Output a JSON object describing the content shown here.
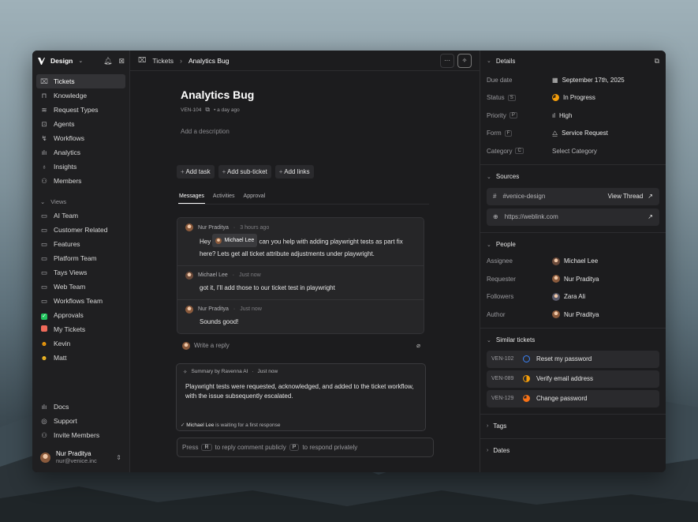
{
  "workspace": {
    "name": "Design"
  },
  "sidebar": {
    "nav": [
      {
        "label": "Tickets",
        "icon": "ticket-icon",
        "glyph": "⌧"
      },
      {
        "label": "Knowledge",
        "icon": "book-icon",
        "glyph": "⊓"
      },
      {
        "label": "Request Types",
        "icon": "layers-icon",
        "glyph": "≋"
      },
      {
        "label": "Agents",
        "icon": "bot-icon",
        "glyph": "⊡"
      },
      {
        "label": "Workflows",
        "icon": "workflow-icon",
        "glyph": "↯"
      },
      {
        "label": "Analytics",
        "icon": "chart-icon",
        "glyph": "ılı"
      },
      {
        "label": "Insights",
        "icon": "lightbulb-icon",
        "glyph": "♁"
      },
      {
        "label": "Members",
        "icon": "users-icon",
        "glyph": "⚇"
      }
    ],
    "views_label": "Views",
    "views": [
      {
        "label": "AI Team",
        "icon": "folder-icon",
        "glyph": "▭"
      },
      {
        "label": "Customer Related",
        "icon": "folder-icon",
        "glyph": "▭"
      },
      {
        "label": "Features",
        "icon": "folder-icon",
        "glyph": "▭"
      },
      {
        "label": "Platform Team",
        "icon": "folder-icon",
        "glyph": "▭"
      },
      {
        "label": "Tays Views",
        "icon": "folder-icon",
        "glyph": "▭"
      },
      {
        "label": "Web Team",
        "icon": "folder-icon",
        "glyph": "▭"
      },
      {
        "label": "Workflows Team",
        "icon": "folder-icon",
        "glyph": "▭"
      },
      {
        "label": "Approvals",
        "icon": "check-square-icon",
        "glyph": "✓",
        "color": "#22c55e"
      },
      {
        "label": "My Tickets",
        "icon": "ticket-square-icon",
        "glyph": "",
        "color": "#ef6a5a"
      },
      {
        "label": "Kevin",
        "icon": "emoji-icon",
        "glyph": "☻",
        "color": "#f59e0b"
      },
      {
        "label": "Matt",
        "icon": "emoji-icon",
        "glyph": "☻",
        "color": "#fbbf24"
      }
    ],
    "bottom": [
      {
        "label": "Docs",
        "icon": "docs-icon",
        "glyph": "ılı"
      },
      {
        "label": "Support",
        "icon": "support-icon",
        "glyph": "◎"
      },
      {
        "label": "Invite Members",
        "icon": "invite-icon",
        "glyph": "⚇"
      }
    ],
    "user": {
      "name": "Nur Praditya",
      "email": "nur@venice.inc"
    }
  },
  "breadcrumb": {
    "section": "Tickets",
    "page": "Analytics Bug"
  },
  "ticket": {
    "title": "Analytics Bug",
    "id": "VEN-104",
    "age": "• a day ago",
    "description_placeholder": "Add a description",
    "actions": [
      "Add task",
      "Add sub-ticket",
      "Add links"
    ],
    "tabs": [
      "Messages",
      "Activities",
      "Approval"
    ]
  },
  "messages": [
    {
      "author": "Nur Praditya",
      "time": "3 hours ago",
      "pre": "Hey",
      "mention": "Michael Lee",
      "post": "can you help with adding playwright tests as part fix here? Lets get all ticket attribute adjustments under playwright."
    },
    {
      "author": "Michael Lee",
      "time": "Just now",
      "text": "got it, I'll add those to our ticket test in playwright"
    },
    {
      "author": "Nur Praditya",
      "time": "Just now",
      "text": "Sounds good!"
    }
  ],
  "reply_placeholder": "Write a reply",
  "summary": {
    "by": "Summary by Ravenna AI",
    "time": "Just now",
    "text": "Playwright tests were requested, acknowledged, and added to the ticket workflow, with the issue subsequently escalated.",
    "waiting_name": "Michael Lee",
    "waiting_text": "is waiting for a first response"
  },
  "composer": {
    "press": "Press",
    "key1": "R",
    "mid": "to reply comment publicly",
    "key2": "P",
    "end": "to respond privately"
  },
  "details": {
    "title": "Details",
    "rows": [
      {
        "label": "Due date",
        "key": "",
        "value": "September 17th, 2025",
        "icon": "calendar-icon",
        "glyph": "▦"
      },
      {
        "label": "Status",
        "key": "S",
        "value": "In Progress",
        "icon": "in-progress-icon",
        "glyph": ""
      },
      {
        "label": "Priority",
        "key": "P",
        "value": "High",
        "icon": "priority-high-icon",
        "glyph": "ıl"
      },
      {
        "label": "Form",
        "key": "F",
        "value": "Service Request",
        "icon": "form-icon",
        "glyph": "⧋"
      },
      {
        "label": "Category",
        "key": "C",
        "value": "Select Category",
        "icon": "",
        "glyph": ""
      }
    ],
    "sources_title": "Sources",
    "sources": [
      {
        "label": "#venice-design",
        "icon": "slack-icon",
        "glyph": "#",
        "action": "View Thread"
      },
      {
        "label": "https://weblink.com",
        "icon": "globe-icon",
        "glyph": "⊕",
        "action": ""
      }
    ],
    "people_title": "People",
    "people": [
      {
        "label": "Assignee",
        "value": "Michael Lee"
      },
      {
        "label": "Requester",
        "value": "Nur Praditya"
      },
      {
        "label": "Followers",
        "value": "Zara Ali"
      },
      {
        "label": "Author",
        "value": "Nur Praditya"
      }
    ],
    "similar_title": "Similar tickets",
    "similar": [
      {
        "id": "VEN-102",
        "title": "Reset my password",
        "status_color": "#3b82f6",
        "status": "open-icon"
      },
      {
        "id": "VEN-089",
        "title": "Verify email address",
        "status_color": "#f59e0b",
        "status": "half-icon"
      },
      {
        "id": "VEN-129",
        "title": "Change password",
        "status_color": "#f97316",
        "status": "in-progress-icon"
      }
    ],
    "tags_title": "Tags",
    "dates_title": "Dates"
  }
}
